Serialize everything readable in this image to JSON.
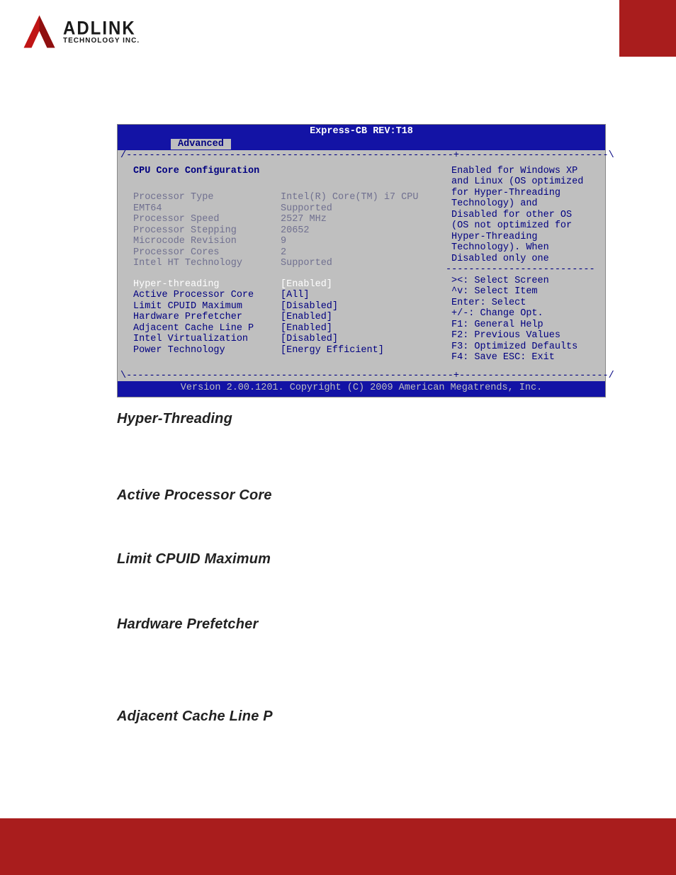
{
  "logo": {
    "name": "ADLINK",
    "sub": "TECHNOLOGY INC."
  },
  "bios": {
    "title": "Express-CB REV:T18",
    "tab": "Advanced",
    "section": "CPU Core Configuration",
    "info": [
      {
        "label": "Processor Type",
        "value": "Intel(R) Core(TM) i7 CPU"
      },
      {
        "label": "EMT64",
        "value": "Supported"
      },
      {
        "label": "Processor Speed",
        "value": "2527 MHz"
      },
      {
        "label": "Processor Stepping",
        "value": "20652"
      },
      {
        "label": "Microcode Revision",
        "value": "9"
      },
      {
        "label": "Processor Cores",
        "value": "2"
      },
      {
        "label": "Intel HT Technology",
        "value": "Supported"
      }
    ],
    "options": [
      {
        "label": "Hyper-threading",
        "value": "[Enabled]",
        "selected": true
      },
      {
        "label": "Active Processor Core",
        "value": "[All]",
        "selected": false
      },
      {
        "label": "Limit CPUID Maximum",
        "value": "[Disabled]",
        "selected": false
      },
      {
        "label": "Hardware Prefetcher",
        "value": "[Enabled]",
        "selected": false
      },
      {
        "label": "Adjacent Cache Line P",
        "value": "[Enabled]",
        "selected": false
      },
      {
        "label": "Intel Virtualization",
        "value": "[Disabled]",
        "selected": false
      },
      {
        "label": "Power Technology",
        "value": "[Energy Efficient]",
        "selected": false
      }
    ],
    "help_text": [
      "Enabled for Windows XP",
      "and Linux (OS optimized",
      "for Hyper-Threading",
      "Technology) and",
      "Disabled for other OS",
      "(OS not optimized for",
      "Hyper-Threading",
      "Technology). When",
      "Disabled only one"
    ],
    "nav": [
      "><: Select Screen",
      "^v: Select Item",
      "Enter: Select",
      "+/-: Change Opt.",
      "F1: General Help",
      "F2: Previous Values",
      "F3: Optimized Defaults",
      "F4: Save  ESC: Exit"
    ],
    "footer": "Version 2.00.1201. Copyright (C) 2009 American Megatrends, Inc.",
    "border_top": "/---------------------------------------------------------+--------------------------\\",
    "border_mid": "                                                          |--------------------------|",
    "border_bot": "\\---------------------------------------------------------+--------------------------/"
  },
  "headings": [
    "Hyper-Threading",
    "Active Processor Core",
    "Limit CPUID Maximum",
    "Hardware Prefetcher",
    "Adjacent Cache Line P"
  ]
}
